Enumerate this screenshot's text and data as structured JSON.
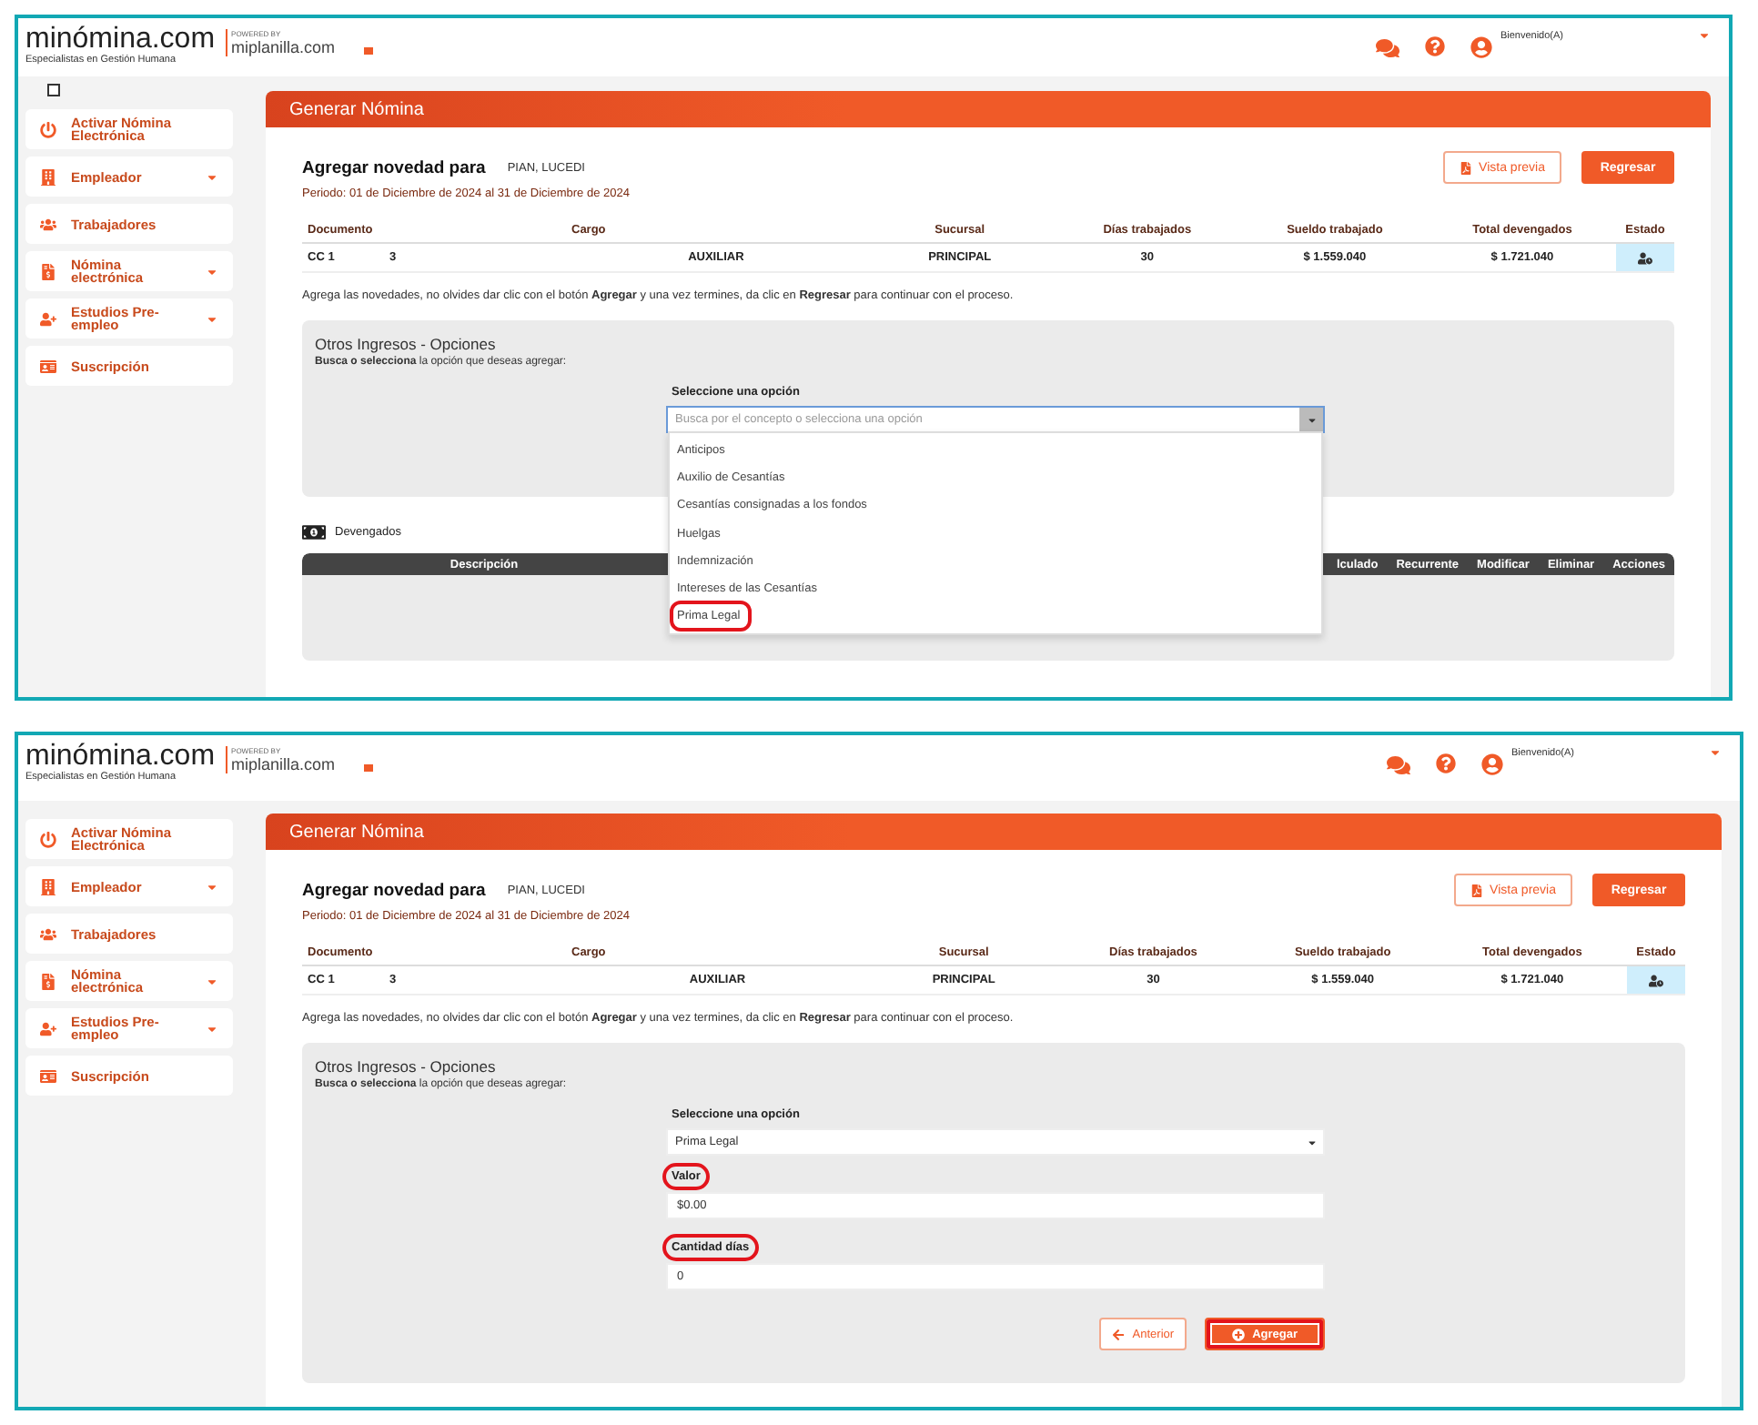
{
  "screens": [
    {
      "brand": {
        "logo": "minómina.com",
        "tagline": "Especialistas en Gestión Humana",
        "powered_by": "POWERED BY",
        "partner": "miplanilla.com"
      },
      "user": {
        "greeting": "Bienvenido(A)"
      },
      "checkbox": {
        "checked": false
      },
      "sidebar": {
        "items": [
          {
            "label": "Activar Nómina Electrónica",
            "has_menu": false
          },
          {
            "label": "Empleador",
            "has_menu": true
          },
          {
            "label": "Trabajadores",
            "has_menu": false
          },
          {
            "label": "Nómina electrónica",
            "has_menu": true
          },
          {
            "label": "Estudios Pre-empleo",
            "has_menu": true
          },
          {
            "label": "Suscripción",
            "has_menu": false
          }
        ]
      },
      "main": {
        "title": "Generar Nómina",
        "heading": "Agregar novedad para",
        "employee": "PIAN, LUCEDI",
        "period": "Periodo: 01 de Diciembre de 2024 al 31 de Diciembre de 2024",
        "preview_button": "Vista previa",
        "back_button": "Regresar",
        "summary": {
          "columns": [
            "Documento",
            "Cargo",
            "Sucursal",
            "Días trabajados",
            "Sueldo trabajado",
            "Total devengados",
            "Estado"
          ],
          "row": [
            "CC 1",
            "3",
            "AUXILIAR",
            "PRINCIPAL",
            "30",
            "$ 1.559.040",
            "$ 1.721.040"
          ]
        },
        "note": "Agrega las novedades, no olvides dar clic con el botón **Agregar** y una vez termines, da clic en **Regresar** para continuar con el proceso.",
        "options": {
          "title": "Otros Ingresos - Opciones",
          "hint": "**Busca o selecciona** la opción que deseas agregar:",
          "select_label": "Seleccione una opción",
          "select": {
            "placeholder": "Busca por el concepto o selecciona una opción",
            "expanded": true,
            "items": [
              {
                "label": "Anticipos",
                "highlighted": false
              },
              {
                "label": "Auxilio de Cesantías",
                "highlighted": false
              },
              {
                "label": "Cesantías consignadas a los fondos",
                "highlighted": false
              },
              {
                "label": "Huelgas",
                "highlighted": false
              },
              {
                "label": "Indemnización",
                "highlighted": false
              },
              {
                "label": "Intereses de las Cesantías",
                "highlighted": false
              },
              {
                "label": "Prima Legal",
                "highlighted": true
              }
            ]
          }
        },
        "devengados": {
          "title": "Devengados",
          "columns": [
            "Descripción",
            "lculado",
            "Recurrente",
            "Modificar",
            "Eliminar",
            "Acciones"
          ]
        }
      }
    },
    {
      "brand": {
        "logo": "minómina.com",
        "tagline": "Especialistas en Gestión Humana",
        "powered_by": "POWERED BY",
        "partner": "miplanilla.com"
      },
      "user": {
        "greeting": "Bienvenido(A)"
      },
      "sidebar": {
        "items": [
          {
            "label": "Activar Nómina Electrónica",
            "has_menu": false
          },
          {
            "label": "Empleador",
            "has_menu": true
          },
          {
            "label": "Trabajadores",
            "has_menu": false
          },
          {
            "label": "Nómina electrónica",
            "has_menu": true
          },
          {
            "label": "Estudios Pre-empleo",
            "has_menu": true
          },
          {
            "label": "Suscripción",
            "has_menu": false
          }
        ]
      },
      "main": {
        "title": "Generar Nómina",
        "heading": "Agregar novedad para",
        "employee": "PIAN, LUCEDI",
        "period": "Periodo: 01 de Diciembre de 2024 al 31 de Diciembre de 2024",
        "preview_button": "Vista previa",
        "back_button": "Regresar",
        "summary": {
          "columns": [
            "Documento",
            "Cargo",
            "Sucursal",
            "Días trabajados",
            "Sueldo trabajado",
            "Total devengados",
            "Estado"
          ],
          "row": [
            "CC 1",
            "3",
            "AUXILIAR",
            "PRINCIPAL",
            "30",
            "$ 1.559.040",
            "$ 1.721.040"
          ]
        },
        "note": "Agrega las novedades, no olvides dar clic con el botón **Agregar** y una vez termines, da clic en **Regresar** para continuar con el proceso.",
        "options": {
          "title": "Otros Ingresos - Opciones",
          "hint": "**Busca o selecciona** la opción que deseas agregar:",
          "select_label": "Seleccione una opción",
          "select": {
            "value": "Prima Legal",
            "expanded": false
          },
          "fields": [
            {
              "label": "Valor",
              "value": "$0.00",
              "highlighted": true
            },
            {
              "label": "Cantidad días",
              "value": "0",
              "highlighted": true
            }
          ],
          "actions": [
            {
              "label": "Anterior",
              "kind": "secondary",
              "highlighted": false
            },
            {
              "label": "Agregar",
              "kind": "primary",
              "highlighted": true
            }
          ]
        }
      }
    }
  ]
}
